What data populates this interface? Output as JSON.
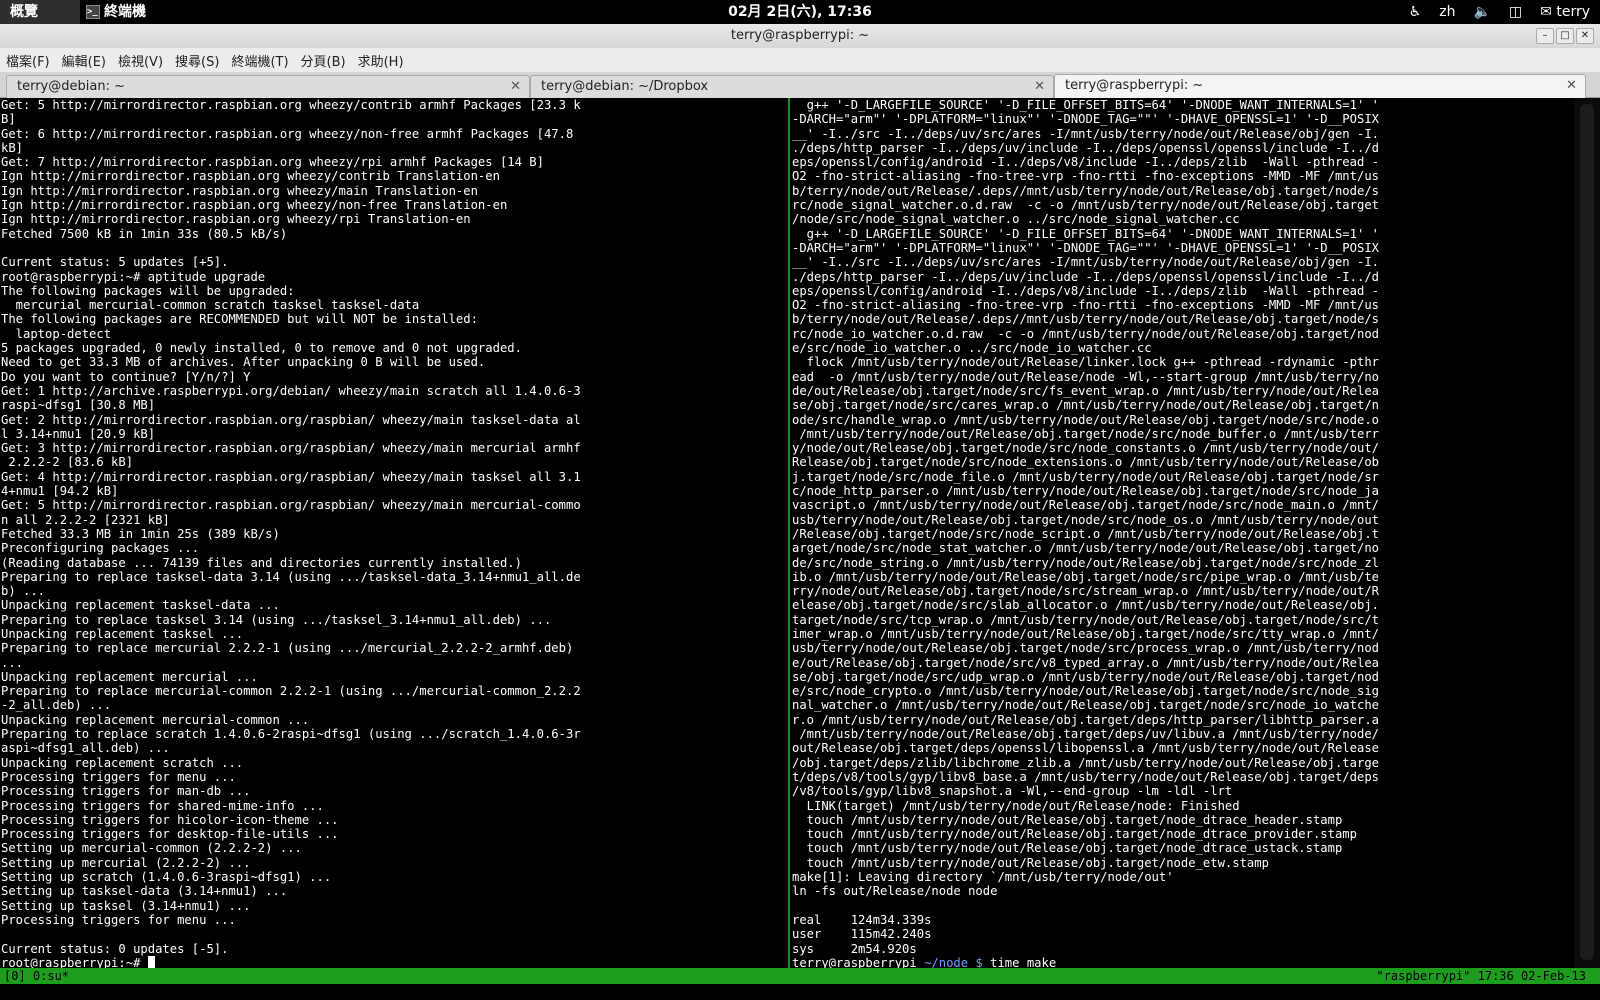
{
  "topbar": {
    "overview": "概覽",
    "app_name": "終端機",
    "clock": "02月 2日(六), 17:36",
    "lang": "zh",
    "user": "terry"
  },
  "window": {
    "title": "terry@raspberrypi: ~"
  },
  "menu": [
    "檔案(F)",
    "編輯(E)",
    "檢視(V)",
    "搜尋(S)",
    "終端機(T)",
    "分頁(B)",
    "求助(H)"
  ],
  "tabs": [
    {
      "label": "terry@debian: ~"
    },
    {
      "label": "terry@debian: ~/Dropbox"
    },
    {
      "label": "terry@raspberrypi: ~"
    }
  ],
  "left_pane": {
    "lines": [
      "Get: 5 http://mirrordirector.raspbian.org wheezy/contrib armhf Packages [23.3 k",
      "B]",
      "Get: 6 http://mirrordirector.raspbian.org wheezy/non-free armhf Packages [47.8",
      "kB]",
      "Get: 7 http://mirrordirector.raspbian.org wheezy/rpi armhf Packages [14 B]",
      "Ign http://mirrordirector.raspbian.org wheezy/contrib Translation-en",
      "Ign http://mirrordirector.raspbian.org wheezy/main Translation-en",
      "Ign http://mirrordirector.raspbian.org wheezy/non-free Translation-en",
      "Ign http://mirrordirector.raspbian.org wheezy/rpi Translation-en",
      "Fetched 7500 kB in 1min 33s (80.5 kB/s)",
      "",
      "Current status: 5 updates [+5].",
      "root@raspberrypi:~# aptitude upgrade",
      "The following packages will be upgraded:",
      "  mercurial mercurial-common scratch tasksel tasksel-data",
      "The following packages are RECOMMENDED but will NOT be installed:",
      "  laptop-detect",
      "5 packages upgraded, 0 newly installed, 0 to remove and 0 not upgraded.",
      "Need to get 33.3 MB of archives. After unpacking 0 B will be used.",
      "Do you want to continue? [Y/n/?] Y",
      "Get: 1 http://archive.raspberrypi.org/debian/ wheezy/main scratch all 1.4.0.6-3",
      "raspi~dfsg1 [30.8 MB]",
      "Get: 2 http://mirrordirector.raspbian.org/raspbian/ wheezy/main tasksel-data al",
      "l 3.14+nmu1 [20.9 kB]",
      "Get: 3 http://mirrordirector.raspbian.org/raspbian/ wheezy/main mercurial armhf",
      " 2.2.2-2 [83.6 kB]",
      "Get: 4 http://mirrordirector.raspbian.org/raspbian/ wheezy/main tasksel all 3.1",
      "4+nmu1 [94.2 kB]",
      "Get: 5 http://mirrordirector.raspbian.org/raspbian/ wheezy/main mercurial-commo",
      "n all 2.2.2-2 [2321 kB]",
      "Fetched 33.3 MB in 1min 25s (389 kB/s)",
      "Preconfiguring packages ...",
      "(Reading database ... 74139 files and directories currently installed.)",
      "Preparing to replace tasksel-data 3.14 (using .../tasksel-data_3.14+nmu1_all.de",
      "b) ...",
      "Unpacking replacement tasksel-data ...",
      "Preparing to replace tasksel 3.14 (using .../tasksel_3.14+nmu1_all.deb) ...",
      "Unpacking replacement tasksel ...",
      "Preparing to replace mercurial 2.2.2-1 (using .../mercurial_2.2.2-2_armhf.deb)",
      "...",
      "Unpacking replacement mercurial ...",
      "Preparing to replace mercurial-common 2.2.2-1 (using .../mercurial-common_2.2.2",
      "-2_all.deb) ...",
      "Unpacking replacement mercurial-common ...",
      "Preparing to replace scratch 1.4.0.6-2raspi~dfsg1 (using .../scratch_1.4.0.6-3r",
      "aspi~dfsg1_all.deb) ...",
      "Unpacking replacement scratch ...",
      "Processing triggers for menu ...",
      "Processing triggers for man-db ...",
      "Processing triggers for shared-mime-info ...",
      "Processing triggers for hicolor-icon-theme ...",
      "Processing triggers for desktop-file-utils ...",
      "Setting up mercurial-common (2.2.2-2) ...",
      "Setting up mercurial (2.2.2-2) ...",
      "Setting up scratch (1.4.0.6-3raspi~dfsg1) ...",
      "Setting up tasksel-data (3.14+nmu1) ...",
      "Setting up tasksel (3.14+nmu1) ...",
      "Processing triggers for menu ...",
      "",
      "Current status: 0 updates [-5]."
    ],
    "prompt": "root@raspberrypi:~# "
  },
  "right_pane": {
    "lines": [
      "  g++ '-D_LARGEFILE_SOURCE' '-D_FILE_OFFSET_BITS=64' '-DNODE_WANT_INTERNALS=1' '",
      "-DARCH=\"arm\"' '-DPLATFORM=\"linux\"' '-DNODE_TAG=\"\"' '-DHAVE_OPENSSL=1' '-D__POSIX",
      "__' -I../src -I../deps/uv/src/ares -I/mnt/usb/terry/node/out/Release/obj/gen -I.",
      "./deps/http_parser -I../deps/uv/include -I../deps/openssl/openssl/include -I../d",
      "eps/openssl/config/android -I../deps/v8/include -I../deps/zlib  -Wall -pthread -",
      "O2 -fno-strict-aliasing -fno-tree-vrp -fno-rtti -fno-exceptions -MMD -MF /mnt/us",
      "b/terry/node/out/Release/.deps//mnt/usb/terry/node/out/Release/obj.target/node/s",
      "rc/node_signal_watcher.o.d.raw  -c -o /mnt/usb/terry/node/out/Release/obj.target",
      "/node/src/node_signal_watcher.o ../src/node_signal_watcher.cc",
      "  g++ '-D_LARGEFILE_SOURCE' '-D_FILE_OFFSET_BITS=64' '-DNODE_WANT_INTERNALS=1' '",
      "-DARCH=\"arm\"' '-DPLATFORM=\"linux\"' '-DNODE_TAG=\"\"' '-DHAVE_OPENSSL=1' '-D__POSIX",
      "__' -I../src -I../deps/uv/src/ares -I/mnt/usb/terry/node/out/Release/obj/gen -I.",
      "./deps/http_parser -I../deps/uv/include -I../deps/openssl/openssl/include -I../d",
      "eps/openssl/config/android -I../deps/v8/include -I../deps/zlib  -Wall -pthread -",
      "O2 -fno-strict-aliasing -fno-tree-vrp -fno-rtti -fno-exceptions -MMD -MF /mnt/us",
      "b/terry/node/out/Release/.deps//mnt/usb/terry/node/out/Release/obj.target/node/s",
      "rc/node_io_watcher.o.d.raw  -c -o /mnt/usb/terry/node/out/Release/obj.target/nod",
      "e/src/node_io_watcher.o ../src/node_io_watcher.cc",
      "  flock /mnt/usb/terry/node/out/Release/linker.lock g++ -pthread -rdynamic -pthr",
      "ead  -o /mnt/usb/terry/node/out/Release/node -Wl,--start-group /mnt/usb/terry/no",
      "de/out/Release/obj.target/node/src/fs_event_wrap.o /mnt/usb/terry/node/out/Relea",
      "se/obj.target/node/src/cares_wrap.o /mnt/usb/terry/node/out/Release/obj.target/n",
      "ode/src/handle_wrap.o /mnt/usb/terry/node/out/Release/obj.target/node/src/node.o",
      " /mnt/usb/terry/node/out/Release/obj.target/node/src/node_buffer.o /mnt/usb/terr",
      "y/node/out/Release/obj.target/node/src/node_constants.o /mnt/usb/terry/node/out/",
      "Release/obj.target/node/src/node_extensions.o /mnt/usb/terry/node/out/Release/ob",
      "j.target/node/src/node_file.o /mnt/usb/terry/node/out/Release/obj.target/node/sr",
      "c/node_http_parser.o /mnt/usb/terry/node/out/Release/obj.target/node/src/node_ja",
      "vascript.o /mnt/usb/terry/node/out/Release/obj.target/node/src/node_main.o /mnt/",
      "usb/terry/node/out/Release/obj.target/node/src/node_os.o /mnt/usb/terry/node/out",
      "/Release/obj.target/node/src/node_script.o /mnt/usb/terry/node/out/Release/obj.t",
      "arget/node/src/node_stat_watcher.o /mnt/usb/terry/node/out/Release/obj.target/no",
      "de/src/node_string.o /mnt/usb/terry/node/out/Release/obj.target/node/src/node_zl",
      "ib.o /mnt/usb/terry/node/out/Release/obj.target/node/src/pipe_wrap.o /mnt/usb/te",
      "rry/node/out/Release/obj.target/node/src/stream_wrap.o /mnt/usb/terry/node/out/R",
      "elease/obj.target/node/src/slab_allocator.o /mnt/usb/terry/node/out/Release/obj.",
      "target/node/src/tcp_wrap.o /mnt/usb/terry/node/out/Release/obj.target/node/src/t",
      "imer_wrap.o /mnt/usb/terry/node/out/Release/obj.target/node/src/tty_wrap.o /mnt/",
      "usb/terry/node/out/Release/obj.target/node/src/process_wrap.o /mnt/usb/terry/nod",
      "e/out/Release/obj.target/node/src/v8_typed_array.o /mnt/usb/terry/node/out/Relea",
      "se/obj.target/node/src/udp_wrap.o /mnt/usb/terry/node/out/Release/obj.target/nod",
      "e/src/node_crypto.o /mnt/usb/terry/node/out/Release/obj.target/node/src/node_sig",
      "nal_watcher.o /mnt/usb/terry/node/out/Release/obj.target/node/src/node_io_watche",
      "r.o /mnt/usb/terry/node/out/Release/obj.target/deps/http_parser/libhttp_parser.a",
      " /mnt/usb/terry/node/out/Release/obj.target/deps/uv/libuv.a /mnt/usb/terry/node/",
      "out/Release/obj.target/deps/openssl/libopenssl.a /mnt/usb/terry/node/out/Release",
      "/obj.target/deps/zlib/libchrome_zlib.a /mnt/usb/terry/node/out/Release/obj.targe",
      "t/deps/v8/tools/gyp/libv8_base.a /mnt/usb/terry/node/out/Release/obj.target/deps",
      "/v8/tools/gyp/libv8_snapshot.a -Wl,--end-group -lm -ldl -lrt",
      "  LINK(target) /mnt/usb/terry/node/out/Release/node: Finished",
      "  touch /mnt/usb/terry/node/out/Release/obj.target/node_dtrace_header.stamp",
      "  touch /mnt/usb/terry/node/out/Release/obj.target/node_dtrace_provider.stamp",
      "  touch /mnt/usb/terry/node/out/Release/obj.target/node_dtrace_ustack.stamp",
      "  touch /mnt/usb/terry/node/out/Release/obj.target/node_etw.stamp",
      "make[1]: Leaving directory `/mnt/usb/terry/node/out'",
      "ln -fs out/Release/node node",
      "",
      "real    124m34.339s",
      "user    115m42.240s",
      "sys     2m54.920s"
    ],
    "prompt_host": "terry@raspberrypi",
    "prompt_path": " ~/node $",
    "prompt_cmd": " time make"
  },
  "status": {
    "left": "[0] 0:su*",
    "right": "\"raspberrypi\" 17:36 02-Feb-13"
  },
  "colors": {
    "status_bar": "#1e9c1e",
    "pane_divider": "#1d8b1d",
    "prompt_path": "#6aa0ff"
  }
}
